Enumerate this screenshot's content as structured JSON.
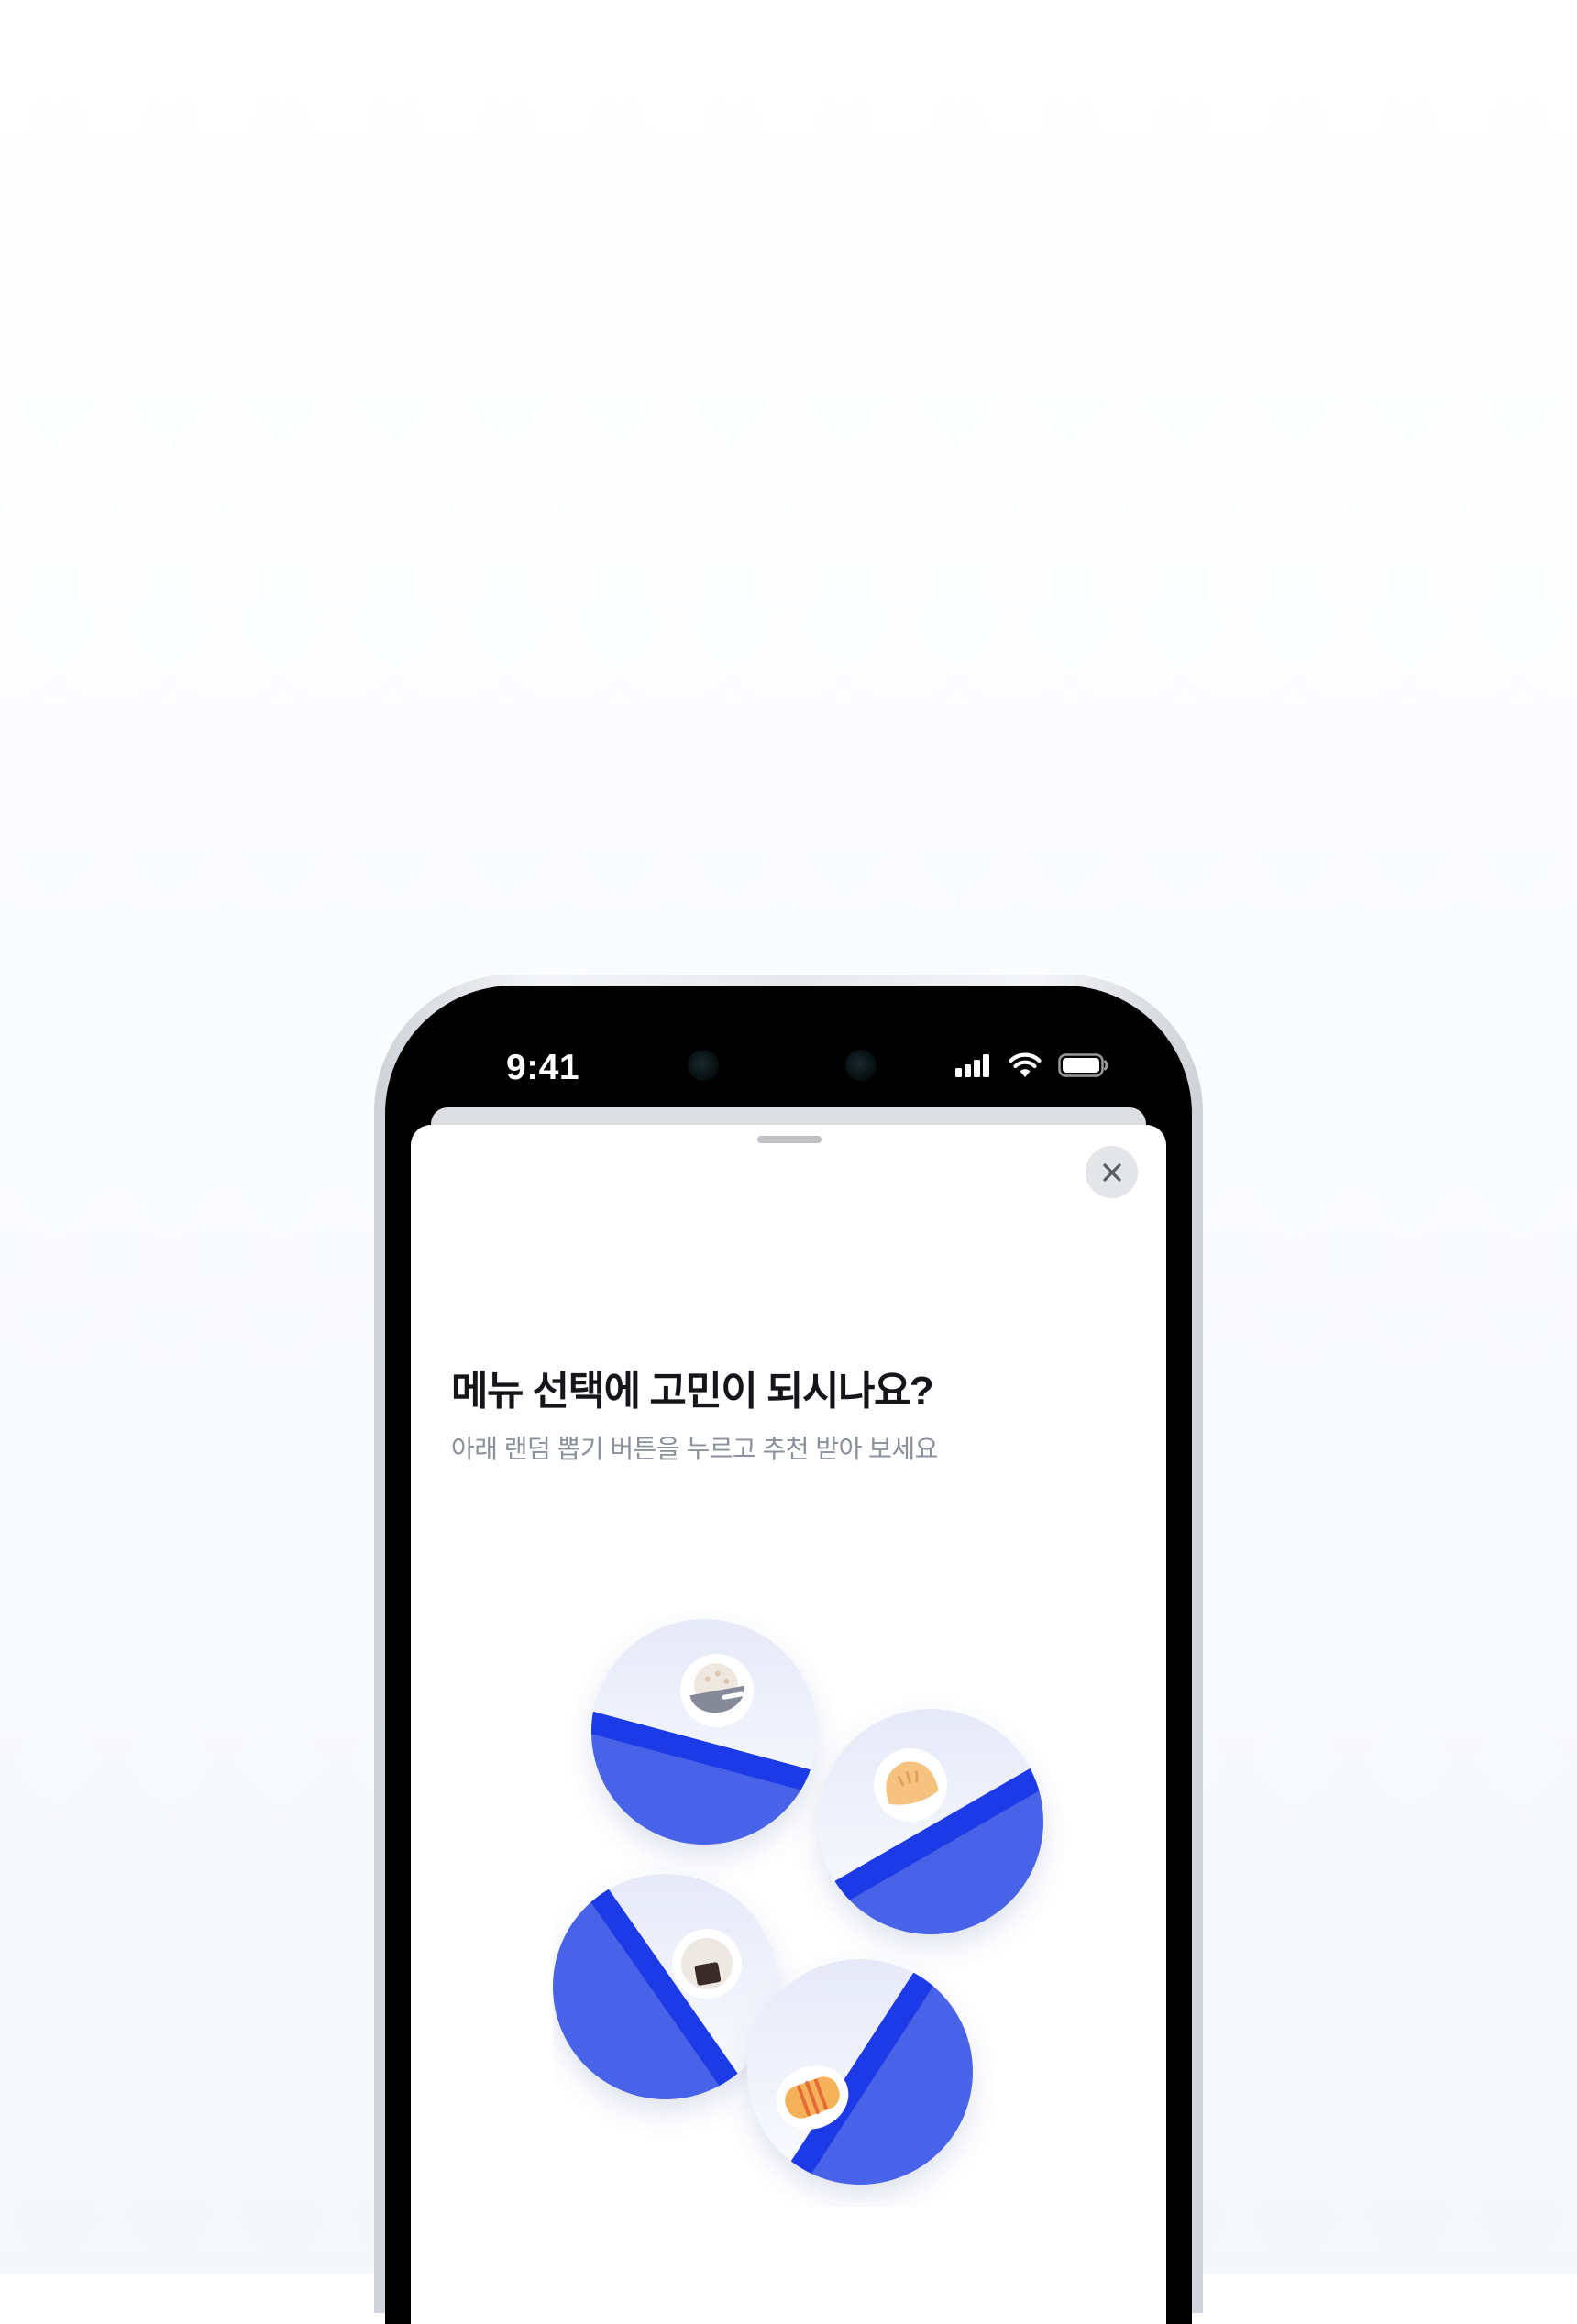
{
  "status_bar": {
    "time": "9:41",
    "icons": [
      "signal-icon",
      "wifi-icon",
      "battery-icon"
    ]
  },
  "sheet": {
    "title": "메뉴 선택에 고민이 되시나요?",
    "subtitle": "아래 랜덤 뽑기 버튼을 누르고 추천 받아 보세요",
    "close_icon": "close-icon"
  },
  "illustration": {
    "items": [
      "rice-bowl-icon",
      "dumpling-icon",
      "rice-ball-icon",
      "bread-icon"
    ]
  },
  "colors": {
    "accent_blue": "#4a63e8",
    "accent_stripe": "#1c3ae6",
    "title_text": "#14161a",
    "subtitle_text": "#8b909a"
  }
}
